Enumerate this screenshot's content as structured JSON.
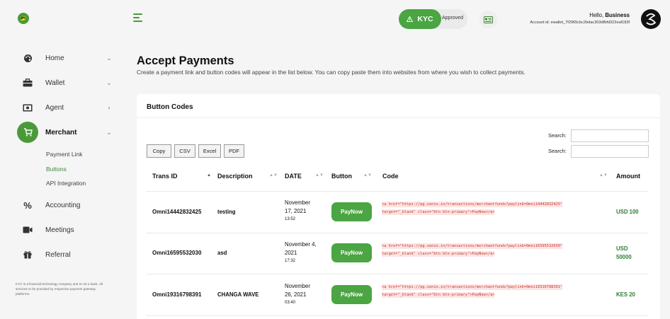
{
  "sidebar": {
    "items": [
      {
        "label": "Home",
        "chevron": "⌄",
        "icon": "palette-icon"
      },
      {
        "label": "Wallet",
        "chevron": "⌄",
        "icon": "briefcase-icon"
      },
      {
        "label": "Agent",
        "chevron": "›",
        "icon": "money-icon"
      },
      {
        "label": "Merchant",
        "chevron": "⌄",
        "icon": "cart-icon"
      },
      {
        "label": "Accounting",
        "icon": "percent-icon"
      },
      {
        "label": "Meetings",
        "icon": "video-icon"
      },
      {
        "label": "Referral",
        "icon": "gift-icon"
      }
    ],
    "sub_items": [
      "Payment Link",
      "Buttons",
      "API Integration"
    ],
    "disclaimer": "KYC is a financial technology company and is not a bank. All services to be provided by respective payment gateway platforms."
  },
  "header": {
    "kyc_label": "KYC",
    "kyc_status": "Approved",
    "greeting": "Hello,",
    "user_name": "Business",
    "account_id": "Account id: ewallet_7f2965cbc2bdac303dfbfd322eaf183f"
  },
  "page": {
    "title": "Accept Payments",
    "subtitle": "Create a payment link and button codes will appear in the list below. You can copy paste them into websites from where you wish to collect payments."
  },
  "card": {
    "title": "Button Codes",
    "search_label": "Search:",
    "export_buttons": [
      "Copy",
      "CSV",
      "Excel",
      "PDF"
    ],
    "columns": [
      "Trans ID",
      "Description",
      "DATE",
      "Button",
      "Code",
      "Amount"
    ],
    "button_label": "PayNow",
    "rows": [
      {
        "id": "Omni14442832425",
        "desc": "testing",
        "date_lines": [
          "November",
          "17, 2021"
        ],
        "time": "13:52",
        "code_lines": [
          "<a href=\"https://pg.xenio.in/transactions/merchantfunds?paylink=Omni14442832425\"",
          "target=\"_blank\" class=\"btn btn-primary\">PayNow</a>"
        ],
        "amount_lines": [
          "USD 100"
        ]
      },
      {
        "id": "Omni16595532030",
        "desc": "asd",
        "date_lines": [
          "November 4,",
          "2021"
        ],
        "time": "17:32",
        "code_lines": [
          "<a href=\"https://pg.xenio.in/transactions/merchantfunds?paylink=Omni16595532030\"",
          "target=\"_blank\" class=\"btn btn-primary\">PayNow</a>"
        ],
        "amount_lines": [
          "USD",
          "50000"
        ]
      },
      {
        "id": "Omni19316798391",
        "desc": "CHANGA WAVE",
        "date_lines": [
          "November",
          "26, 2021"
        ],
        "time": "03:40",
        "code_lines": [
          "<a href=\"https://pg.xenio.in/transactions/merchantfunds?paylink=Omni19316798391\"",
          "target=\"_blank\" class=\"btn btn-primary\">PayNow</a>"
        ],
        "amount_lines": [
          "KES 20"
        ]
      }
    ]
  },
  "colors": {
    "accent": "#4aa542",
    "amount": "#2e7d32",
    "code": "#c0392b"
  }
}
